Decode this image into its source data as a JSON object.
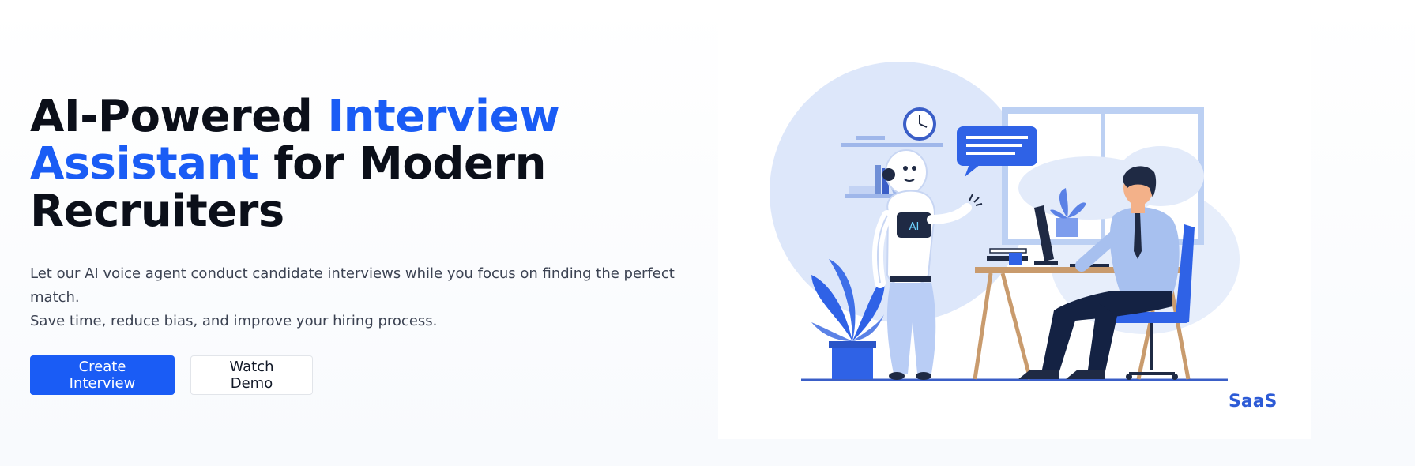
{
  "hero": {
    "headline_part1": "AI-Powered ",
    "headline_accent1": "Interview",
    "headline_accent2": "Assistant",
    "headline_part2": " for Modern",
    "headline_part3": "Recruiters",
    "subtext_line1": "Let our AI voice agent conduct candidate interviews while you focus on finding the perfect match.",
    "subtext_line2": "Save time, reduce bias, and improve your hiring process.",
    "primary_button": "Create Interview",
    "secondary_button": "Watch Demo"
  },
  "illustration": {
    "robot_chest_label": "AI",
    "brand_label": "SaaS"
  },
  "colors": {
    "accent": "#1a5cf5",
    "heading": "#0b0f19",
    "body_text": "#3b4252"
  }
}
